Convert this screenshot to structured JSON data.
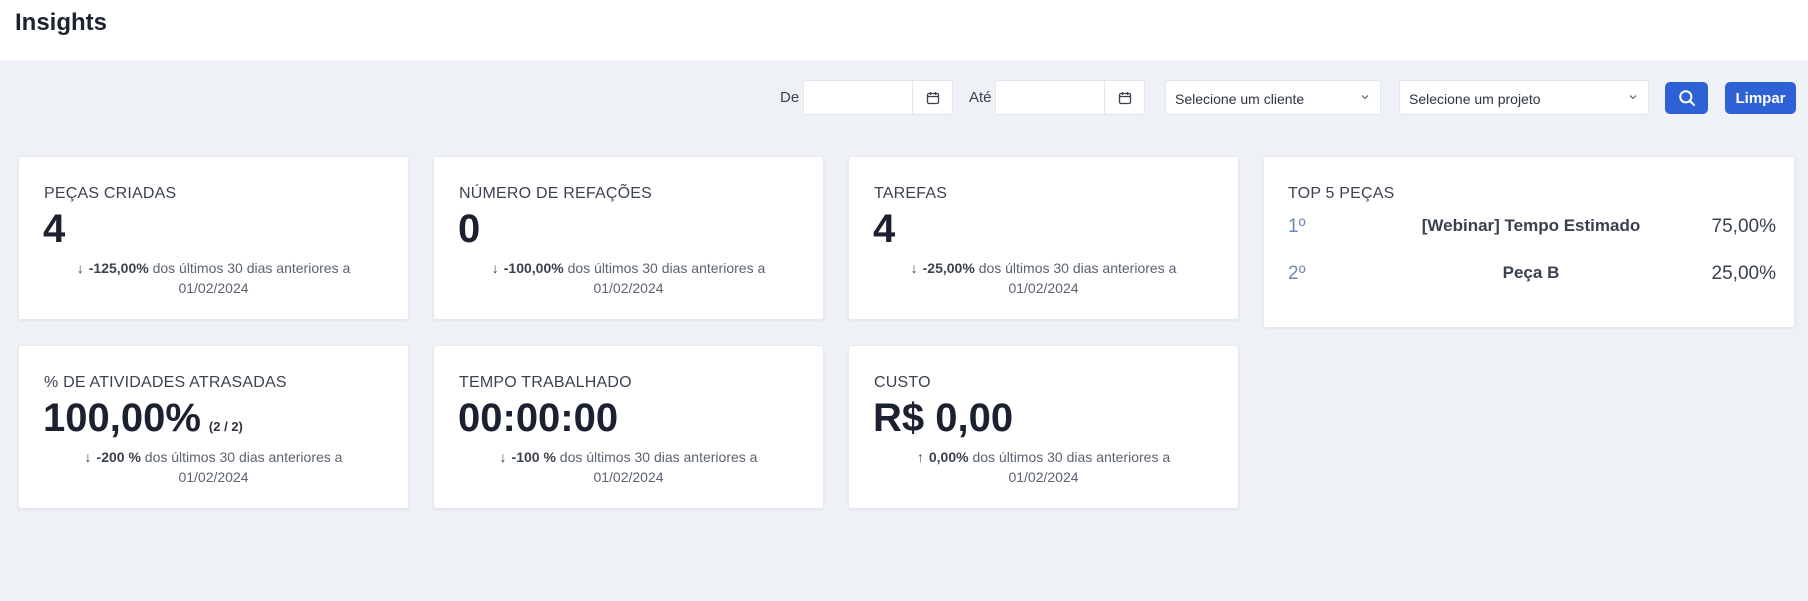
{
  "header": {
    "title": "Insights"
  },
  "filters": {
    "from_label": "De",
    "to_label": "Até",
    "from_value": "",
    "to_value": "",
    "client_select": "Selecione um cliente",
    "project_select": "Selecione um projeto",
    "clear_label": "Limpar"
  },
  "cards": [
    {
      "title": "PEÇAS CRIADAS",
      "value": "4",
      "value_sub": "",
      "arrow": "↓",
      "delta": "-125,00%",
      "text": "dos últimos 30 dias anteriores a",
      "date": "01/02/2024"
    },
    {
      "title": "NÚMERO DE REFAÇÕES",
      "value": "0",
      "value_sub": "",
      "arrow": "↓",
      "delta": "-100,00%",
      "text": "dos últimos 30 dias anteriores a",
      "date": "01/02/2024"
    },
    {
      "title": "TAREFAS",
      "value": "4",
      "value_sub": "",
      "arrow": "↓",
      "delta": "-25,00%",
      "text": "dos últimos 30 dias anteriores a",
      "date": "01/02/2024"
    },
    {
      "title": "% DE ATIVIDADES ATRASADAS",
      "value": "100,00%",
      "value_sub": "(2 / 2)",
      "arrow": "↓",
      "delta": "-200 %",
      "text": "dos últimos 30 dias anteriores a",
      "date": "01/02/2024"
    },
    {
      "title": "TEMPO TRABALHADO",
      "value": "00:00:00",
      "value_sub": "",
      "arrow": "↓",
      "delta": "-100 %",
      "text": "dos últimos 30 dias anteriores a",
      "date": "01/02/2024"
    },
    {
      "title": "CUSTO",
      "value": "R$ 0,00",
      "value_sub": "",
      "arrow": "↑",
      "delta": "0,00%",
      "text": "dos últimos 30 dias anteriores a",
      "date": "01/02/2024"
    }
  ],
  "top5": {
    "title": "TOP 5 PEÇAS",
    "items": [
      {
        "rank": "1º",
        "name": "[Webinar] Tempo Estimado",
        "pct": "75,00%"
      },
      {
        "rank": "2º",
        "name": "Peça B",
        "pct": "25,00%"
      }
    ]
  },
  "colors": {
    "primary": "#2e61d6",
    "background": "#eef1f6",
    "rank": "#6c8ab5"
  },
  "icons": {
    "calendar": "calendar-icon",
    "search": "search-icon",
    "chevron": "chevron-down-icon"
  }
}
